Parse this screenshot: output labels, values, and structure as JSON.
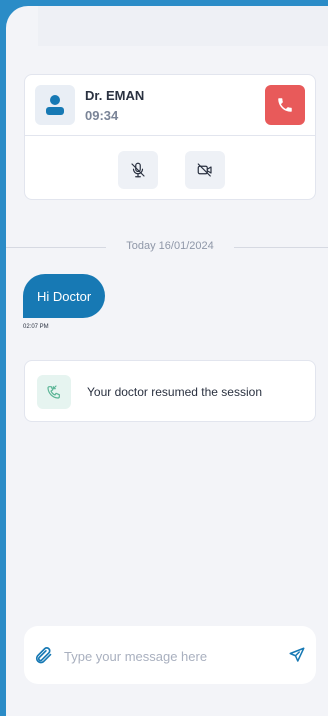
{
  "call": {
    "doctor_name": "Dr. EMAN",
    "timer": "09:34",
    "icons": {
      "avatar": "user-icon",
      "end_call": "phone-hangup-icon",
      "mic": "mic-off-icon",
      "camera": "camera-off-icon"
    }
  },
  "chat": {
    "date_divider": "Today 16/01/2024",
    "messages": [
      {
        "text": "Hi Doctor",
        "time": "02:07 PM"
      }
    ],
    "system_message": {
      "icon": "phone-resume-icon",
      "text": "Your doctor resumed the session"
    }
  },
  "composer": {
    "placeholder": "Type your message here",
    "attach_icon": "paperclip-icon",
    "send_icon": "send-icon"
  },
  "colors": {
    "primary": "#1779b4",
    "danger": "#e85a5a",
    "success_bg": "#e6f4f0",
    "background": "#f3f4f8"
  }
}
